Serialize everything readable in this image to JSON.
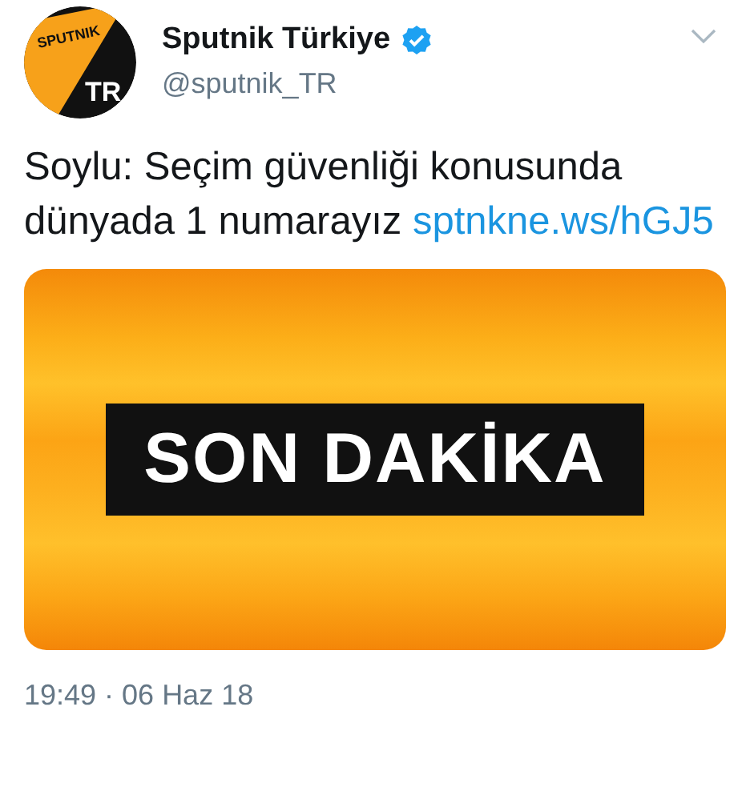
{
  "tweet": {
    "avatar": {
      "top_text": "SPUTNIK",
      "bottom_text": "TR"
    },
    "display_name": "Sputnik Türkiye",
    "verified": true,
    "handle": "@sputnik_TR",
    "text": "Soylu: Seçim güvenliği konusunda dünyada 1 numarayız ",
    "link": "sptnkne.ws/hGJ5",
    "media": {
      "label": "SON DAKİKA"
    },
    "timestamp": "19:49 · 06 Haz 18"
  }
}
